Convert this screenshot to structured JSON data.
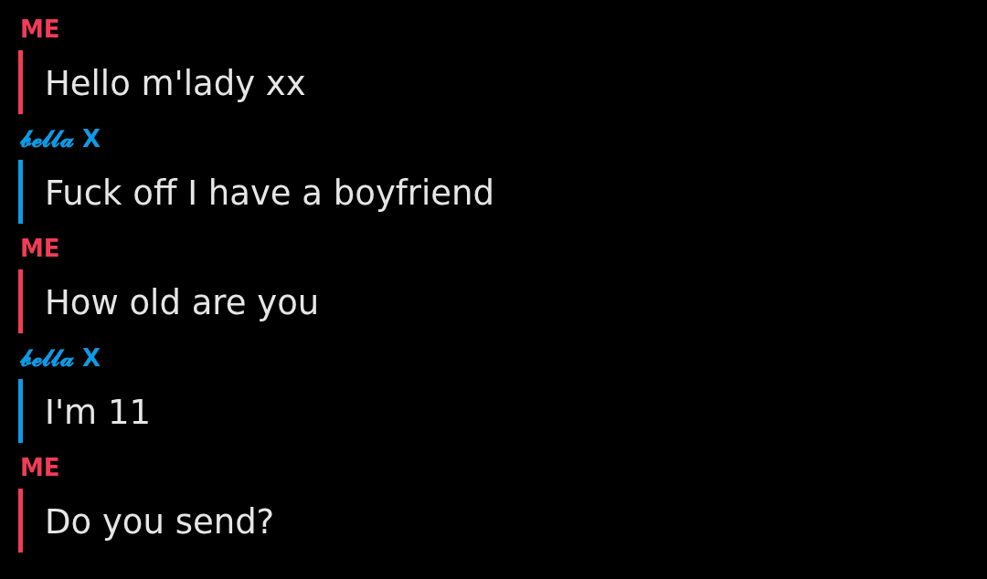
{
  "messages": [
    {
      "sender": "ME",
      "color": "#f23c57",
      "text": "Hello m'lady xx"
    },
    {
      "sender": "𝓫𝓮𝓵𝓵𝓪 X",
      "color": "#0e9be5",
      "text": "Fuck off I have a boyfriend"
    },
    {
      "sender": "ME",
      "color": "#f23c57",
      "text": "How old are you"
    },
    {
      "sender": "𝓫𝓮𝓵𝓵𝓪 X",
      "color": "#0e9be5",
      "text": "I'm 11"
    },
    {
      "sender": "ME",
      "color": "#f23c57",
      "text": "Do you send?"
    }
  ]
}
